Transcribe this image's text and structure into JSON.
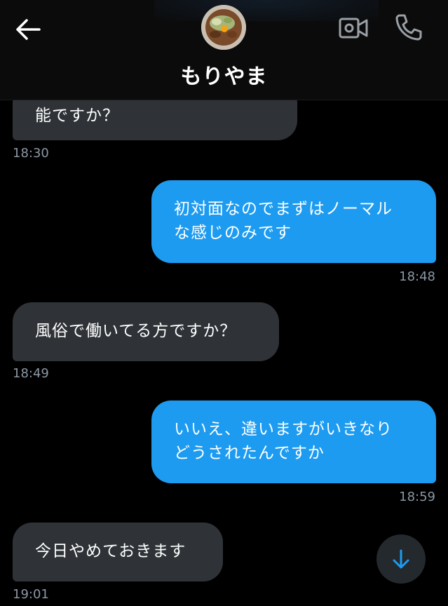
{
  "header": {
    "contact_name": "もりやま",
    "icons": {
      "back": "arrow-left-icon",
      "video": "video-camera-icon",
      "call": "phone-icon"
    }
  },
  "messages": [
    {
      "direction": "incoming",
      "text": "能ですか？",
      "time": "18:30"
    },
    {
      "direction": "outgoing",
      "line1": "初対面なのでまずはノーマル",
      "line2": "な感じのみです",
      "time": "18:48"
    },
    {
      "direction": "incoming",
      "text": "風俗で働いてる方ですか？",
      "time": "18:49"
    },
    {
      "direction": "outgoing",
      "line1": "いいえ、違いますがいきなり",
      "line2": "どうされたんですか",
      "time": "18:59"
    },
    {
      "direction": "incoming",
      "text": "今日やめておきます",
      "time": "19:01"
    }
  ],
  "scroll_button": {
    "icon": "arrow-down-icon"
  },
  "colors": {
    "incoming_bubble": "#2f3337",
    "outgoing_bubble": "#1d9bf0",
    "accent": "#1d9bf0"
  }
}
